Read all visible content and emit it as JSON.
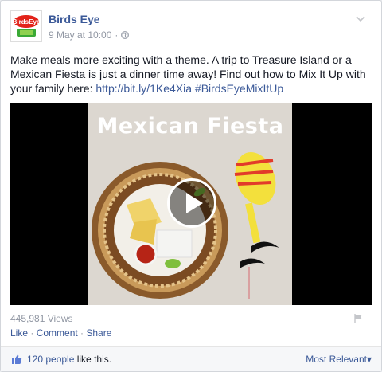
{
  "post": {
    "page_name": "Birds Eye",
    "timestamp": "9 May at 10:00",
    "separator": "·",
    "logo_text": "BirdsEye",
    "text_parts": [
      "Make meals more exciting with a theme. A trip to Treasure Island or a Mexican Fiesta is just a dinner time away! Find out how to Mix It Up with your family here: ",
      "http://bit.ly/1Ke4Xia",
      " ",
      "#BirdsEyeMixItUp"
    ]
  },
  "video": {
    "title": "Mexican Fiesta",
    "views": "445,981 Views"
  },
  "actions": {
    "like": "Like",
    "comment": "Comment",
    "share": "Share",
    "dot": " · "
  },
  "footer": {
    "likes_count": "120 people",
    "likes_suffix": " like this.",
    "sort_label": "Most Relevant",
    "sort_arrow": "▾"
  },
  "colors": {
    "link": "#3b5998",
    "muted": "#9197a3",
    "text": "#141823",
    "footer_bg": "#f6f7f9"
  }
}
